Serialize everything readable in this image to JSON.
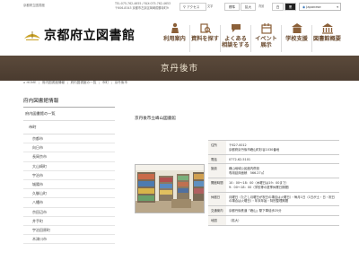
{
  "top": {
    "site_name_small": "京都府立図書館",
    "contact_lines": [
      "TEL:075-762-4655 / FAX:075-762-4653",
      "〒606-8343 京都市左京区岡崎成勝寺町9"
    ],
    "access_label": "アクセス",
    "textsize_label": "文字",
    "size_std": "標準",
    "size_large": "拡大",
    "colors_label": "背景",
    "color_white": "白",
    "color_black": "黒",
    "language": "Japanese"
  },
  "header": {
    "logo_text": "京都府立図書館",
    "nav": [
      {
        "label": "利用案内",
        "icon": "guide-icon"
      },
      {
        "label": "資料を探す",
        "icon": "book-search-icon"
      },
      {
        "label": "よくある相談をする",
        "lines": [
          "よくある",
          "相談をする"
        ],
        "icon": "consult-icon"
      },
      {
        "label": "イベント展示",
        "lines": [
          "イベント",
          "展示"
        ],
        "icon": "event-icon"
      },
      {
        "label": "学校支援",
        "icon": "school-icon"
      },
      {
        "label": "図書館概要",
        "icon": "library-icon"
      }
    ]
  },
  "banner": {
    "title": "京丹後市"
  },
  "breadcrumb": [
    "HOME",
    "府内図書館情報",
    "府内図書館の一覧",
    "市町",
    "京丹後市"
  ],
  "sidebar": {
    "heading": "府内図書館情報",
    "sub": "府内図書館の一覧",
    "sub2": "市町",
    "items": [
      "京都市",
      "向日市",
      "長岡京市",
      "大山崎町",
      "宇治市",
      "城陽市",
      "久御山町",
      "八幡市",
      "京田辺市",
      "井手町",
      "宇治田原町",
      "木津川市"
    ]
  },
  "main": {
    "title": "京丹後市立峰山図書館",
    "rows": [
      {
        "label": "住所",
        "lines": [
          "〒627-0012",
          "京都府京丹後市峰山町杉谷1030番地"
        ]
      },
      {
        "label": "電話",
        "lines": [
          "0772-62-5101"
        ]
      },
      {
        "label": "施設",
        "lines": [
          "峰山地域公民館内併設",
          "専用延床面積　566.27㎡"
        ]
      },
      {
        "label": "開館時間",
        "lines": [
          "10：00～18：00（木曜日は19：00まで）",
          "9：00～18：00（学校等の夏季休業日期間）"
        ]
      },
      {
        "label": "休館日",
        "lines": [
          "月曜日（ただし月曜日が祝日の場合は火曜日）・毎月1日（1日が土・日・祝日の場合は火曜日）・年末年始・特別整理期間"
        ]
      },
      {
        "label": "交通案内",
        "lines": [
          "京都丹後鉄道「峰山」駅下車徒歩25分"
        ]
      },
      {
        "label": "地図",
        "lines": [
          "（拡大）"
        ]
      }
    ]
  }
}
